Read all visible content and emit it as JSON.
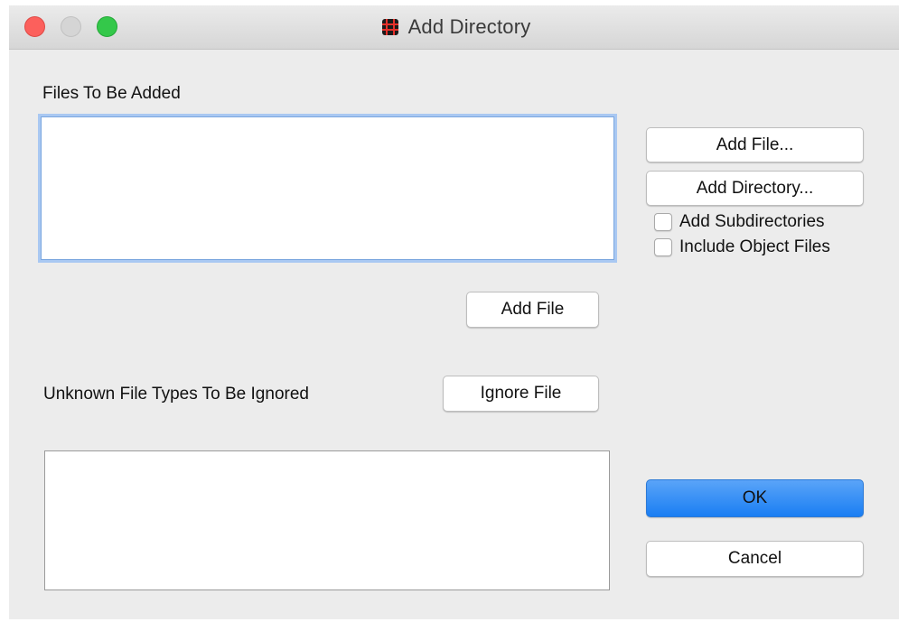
{
  "window": {
    "title": "Add Directory",
    "app_icon": "app-grid-icon",
    "traffic_lights": {
      "close_color": "#fc605c",
      "minimize_color": "#d5d5d5",
      "zoom_color": "#34c84a"
    }
  },
  "files_section": {
    "label": "Files To Be Added",
    "items": []
  },
  "side_actions": {
    "add_file_dialog_label": "Add File...",
    "add_directory_dialog_label": "Add Directory...",
    "add_subdirectories_label": "Add Subdirectories",
    "add_subdirectories_checked": false,
    "include_object_files_label": "Include Object Files",
    "include_object_files_checked": false
  },
  "add_file_label": "Add File",
  "ignored_section": {
    "label": "Unknown File Types To Be Ignored",
    "ignore_file_label": "Ignore File",
    "items": []
  },
  "footer": {
    "ok_label": "OK",
    "cancel_label": "Cancel",
    "ok_color": "#1a7ef3"
  }
}
